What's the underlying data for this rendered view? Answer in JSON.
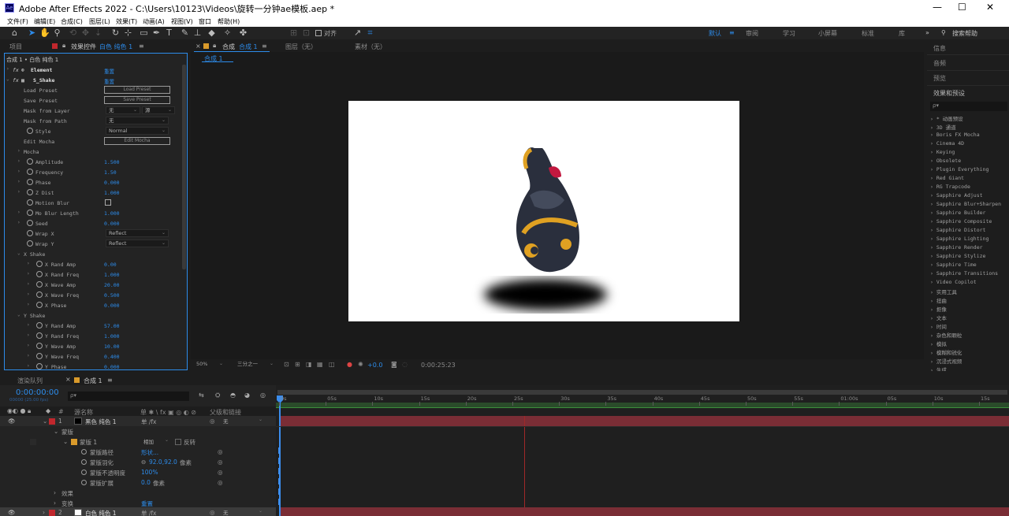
{
  "app": {
    "title": "Adobe After Effects 2022 - C:\\Users\\10123\\Videos\\旋转一分钟ae模板.aep *",
    "icon_text": "Ae",
    "window_controls": [
      "—",
      "☐",
      "✕"
    ]
  },
  "menu": [
    "文件(F)",
    "编辑(E)",
    "合成(C)",
    "图层(L)",
    "效果(T)",
    "动画(A)",
    "视图(V)",
    "窗口",
    "帮助(H)"
  ],
  "toolbar": {
    "snap_label": "对齐",
    "workspaces": [
      "默认",
      "审阅",
      "学习",
      "小屏幕",
      "标准",
      "库"
    ],
    "search_label": "搜索帮助",
    "more": "»"
  },
  "left_panel": {
    "tab_project": "项目",
    "tab_effects": "效果控件",
    "tab_effects_target": "白色 纯色 1",
    "breadcrumb": "合成 1 • 白色 纯色 1",
    "fx_element": "Element",
    "fx_sshake": "S_Shake",
    "reset": "重置",
    "load_preset_lbl": "Load Preset",
    "load_preset_btn": "Load Preset",
    "save_preset_lbl": "Save Preset",
    "save_preset_btn": "Save Preset",
    "mask_layer_lbl": "Mask from Layer",
    "mask_layer_val": "无",
    "mask_layer_val2": "源",
    "mask_path_lbl": "Mask from Path",
    "mask_path_val": "无",
    "style_lbl": "Style",
    "style_val": "Normal",
    "edit_mocha_lbl": "Edit Mocha",
    "edit_mocha_btn": "Edit Mocha",
    "mocha": "Mocha",
    "amplitude_lbl": "Amplitude",
    "amplitude": "1.500",
    "frequency_lbl": "Frequency",
    "frequency": "1.50",
    "phase_lbl": "Phase",
    "phase": "0.000",
    "zdist_lbl": "Z Dist",
    "zdist": "1.000",
    "motion_blur_lbl": "Motion Blur",
    "mo_blur_len_lbl": "Mo Blur Length",
    "mo_blur_len": "1.000",
    "seed_lbl": "Seed",
    "seed": "0.000",
    "wrapx_lbl": "Wrap X",
    "wrapx": "Reflect",
    "wrapy_lbl": "Wrap Y",
    "wrapy": "Reflect",
    "xshake": "X Shake",
    "x_rand_amp_lbl": "X Rand Amp",
    "x_rand_amp": "0.00",
    "x_rand_freq_lbl": "X Rand Freq",
    "x_rand_freq": "1.000",
    "x_wave_amp_lbl": "X Wave Amp",
    "x_wave_amp": "20.00",
    "x_wave_freq_lbl": "X Wave Freq",
    "x_wave_freq": "0.500",
    "x_phase_lbl": "X Phase",
    "x_phase": "0.000",
    "yshake": "Y Shake",
    "y_rand_amp_lbl": "Y Rand Amp",
    "y_rand_amp": "57.00",
    "y_rand_freq_lbl": "Y Rand Freq",
    "y_rand_freq": "1.000",
    "y_wave_amp_lbl": "Y Wave Amp",
    "y_wave_amp": "10.00",
    "y_wave_freq_lbl": "Y Wave Freq",
    "y_wave_freq": "0.400",
    "y_phase_lbl": "Y Phase",
    "y_phase": "0.000"
  },
  "viewer": {
    "tab_comp_prefix": "合成",
    "tab_comp_name": "合成 1",
    "tab_layer": "图层（无）",
    "tab_footage": "素材（无）",
    "comp_crumb": "合成 1",
    "zoom": "50%",
    "resolution": "三分之一",
    "exposure": "+0.0",
    "timecode": "0:00:25:23"
  },
  "right_panel": {
    "info": "信息",
    "audio": "音频",
    "preview": "预览",
    "effects_presets": "效果和预设",
    "search_hint": "ρ▾",
    "categories": [
      "* 动画预设",
      "3D 通道",
      "Boris FX Mocha",
      "Cinema 4D",
      "Keying",
      "Obsolete",
      "Plugin Everything",
      "Red Giant",
      "RG Trapcode",
      "Sapphire Adjust",
      "Sapphire Blur+Sharpen",
      "Sapphire Builder",
      "Sapphire Composite",
      "Sapphire Distort",
      "Sapphire Lighting",
      "Sapphire Render",
      "Sapphire Stylize",
      "Sapphire Time",
      "Sapphire Transitions",
      "Video Copilot",
      "实用工具",
      "扭曲",
      "抠像",
      "文本",
      "时间",
      "杂色和颗粒",
      "模拟",
      "模糊和锐化",
      "沉浸式视频",
      "生成"
    ]
  },
  "timeline": {
    "tab_render": "渲染队列",
    "tab_comp": "合成 1",
    "current_time": "0:00:00:00",
    "fps_info": "00000 (25.00 fps)",
    "search_hint": "ρ▾",
    "col_num": "#",
    "col_source": "源名称",
    "col_switches": "单 ✱ \\ fx ▣ ◎ ◐ ⊘",
    "col_parent": "父级和链接",
    "layer1_num": "1",
    "layer1_name": "黑色 纯色 1",
    "layer1_parent": "无",
    "masks_lbl": "蒙版",
    "mask1_lbl": "蒙版 1",
    "mask_mode": "相加",
    "mask_invert": "反转",
    "mask_path_lbl": "蒙版路径",
    "mask_path_val": "形状...",
    "mask_feather_lbl": "蒙版羽化",
    "mask_feather_val": "92.0,92.0",
    "mask_feather_unit": "像素",
    "mask_opacity_lbl": "蒙版不透明度",
    "mask_opacity_val": "100%",
    "mask_expansion_lbl": "蒙版扩展",
    "mask_expansion_val": "0.0",
    "mask_expansion_unit": "像素",
    "effects_lbl": "效果",
    "transform_lbl": "变换",
    "transform_reset": "重置",
    "layer2_num": "2",
    "layer2_name": "白色 纯色 1",
    "layer2_parent": "无",
    "ruler": [
      "0s",
      "05s",
      "10s",
      "15s",
      "20s",
      "25s",
      "30s",
      "35s",
      "40s",
      "45s",
      "50s",
      "55s",
      "01:00s",
      "05s",
      "10s",
      "15s"
    ]
  },
  "colors": {
    "accent_blue": "#2d8ceb",
    "layer_red": "#7a2d35",
    "label_red": "#c1272d",
    "panel_bg": "#232323",
    "app_bg": "#1d1d1d"
  }
}
